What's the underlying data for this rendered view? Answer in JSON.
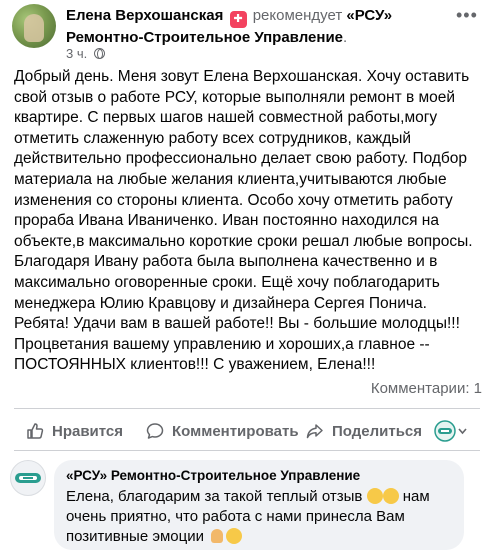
{
  "post": {
    "author": "Елена Верхошанская",
    "verb": "рекомендует",
    "page_name": "«РСУ» Ремонтно-Строительное Управление",
    "page_period": ".",
    "time": "3 ч.",
    "body": "Добрый день. Меня зовут Елена Верхошанская. Хочу оставить свой отзыв о работе РСУ, которые выполняли ремонт в моей квартире. С первых шагов нашей совместной работы,могу отметить слаженную работу всех сотрудников, каждый действительно профессионально делает свою работу. Подбор материала на любые желания клиента,учитываются любые изменения со стороны клиента. Особо хочу отметить работу прораба Ивана Иваниченко. Иван постоянно находился на объекте,в максимально короткие сроки решал любые вопросы. Благодаря Ивану работа была выполнена качественно и в максимально оговоренные сроки.  Ещё хочу поблагодарить менеджера Юлию Кравцову и дизайнера Сергея Понича. Ребята! Удачи вам в вашей работе!! Вы - большие молодцы!!! Процветания вашему управлению и хороших,а главное --ПОСТОЯННЫХ  клиентов!!! С уважением, Елена!!!",
    "comments_count": "Комментарии: 1"
  },
  "actions": {
    "like": "Нравится",
    "comment": "Комментировать",
    "share": "Поделиться"
  },
  "reply": {
    "author": "«РСУ» Ремонтно-Строительное Управление",
    "text_1": "Елена, благодарим за такой теплый отзыв",
    "text_2": "нам очень приятно, что работа с нами принесла Вам позитивные эмоции"
  },
  "colors": {
    "accent_red": "#f3425f",
    "secondary_text": "#65676b",
    "bubble_bg": "#f0f2f5",
    "brand_teal": "#2a9d8f"
  },
  "icons": [
    "avatar",
    "recommend-icon",
    "globe-icon",
    "more-icon",
    "like-icon",
    "comment-icon",
    "share-icon",
    "page-logo-icon",
    "emoji-icon"
  ]
}
